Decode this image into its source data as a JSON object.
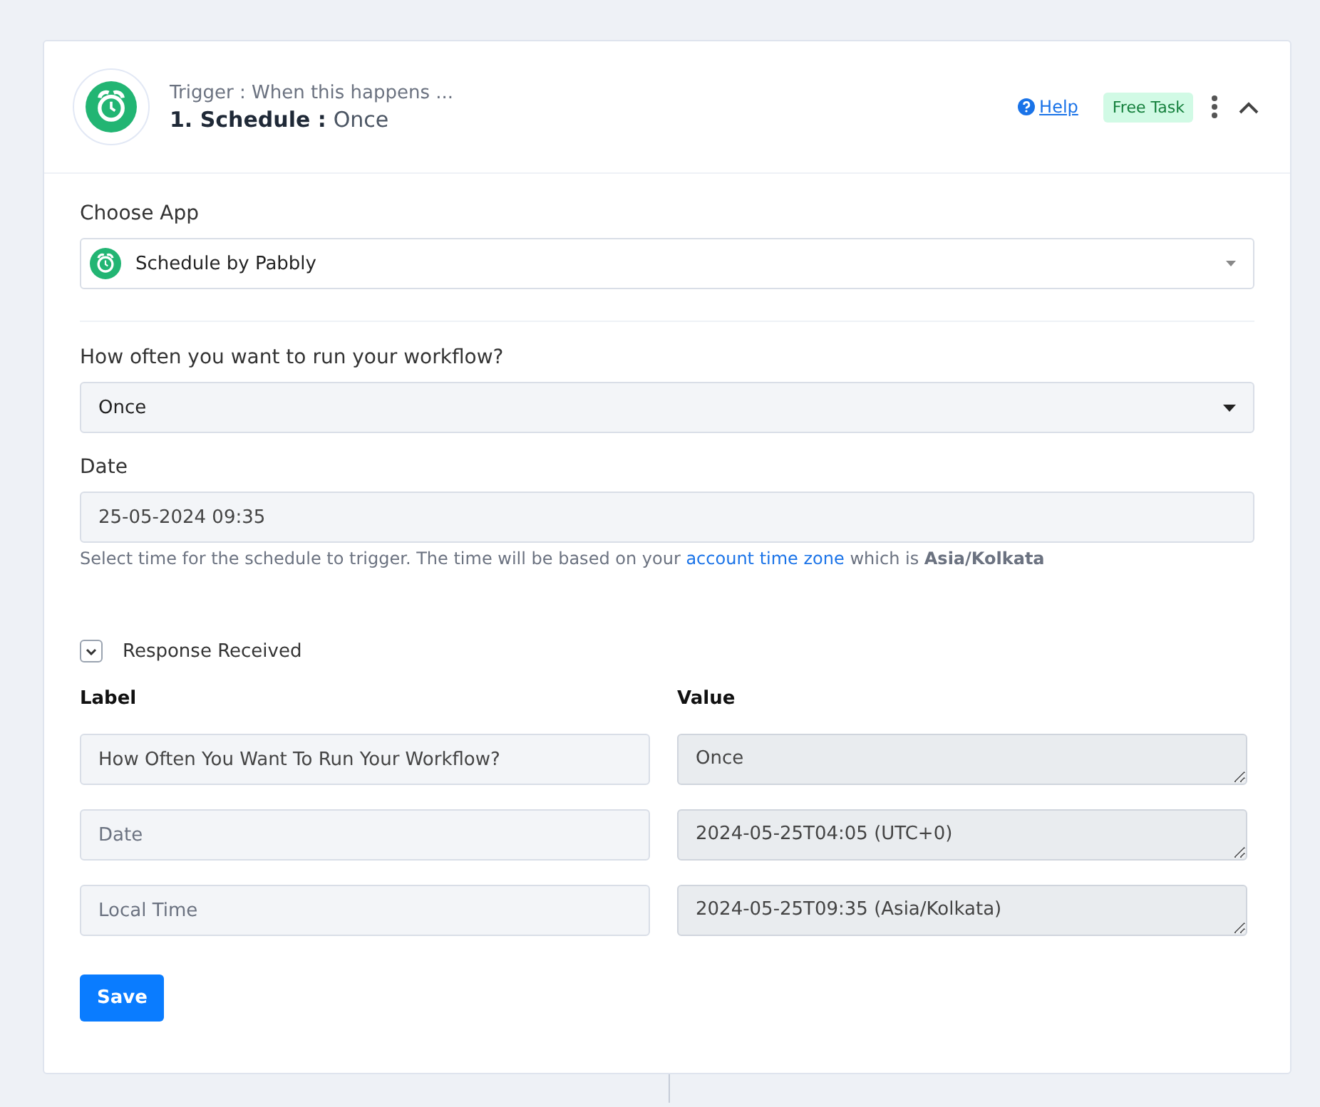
{
  "header": {
    "subtitle": "Trigger : When this happens ...",
    "title": "1. Schedule :",
    "title_value": "Once",
    "help_link": "Help",
    "badge": "Free Task",
    "collapsed": false
  },
  "choose_app": {
    "label": "Choose App",
    "value": "Schedule by Pabbly"
  },
  "frequency": {
    "label": "How often you want to run your workflow?",
    "value": "Once"
  },
  "date": {
    "label": "Date",
    "value": "25-05-2024 09:35",
    "hint_before": "Select time for the schedule to trigger. The time will be based on your",
    "hint_link": "account time zone",
    "hint_after": "which is **Asia/Kolkata**"
  },
  "response": {
    "label": "Response Received",
    "expanded": true,
    "columns": [
      "Label",
      "Value"
    ],
    "rows": [
      {
        "label": {
          "value": "How Often You Want To Run Your Workflow?"
        },
        "value": "Once"
      },
      {
        "label": {
          "placeholder": "Date"
        },
        "value": "2024-05-25T04:05 (UTC+0)"
      },
      {
        "label": {
          "placeholder": "Local Time"
        },
        "value": "2024-05-25T09:35 (Asia/Kolkata)"
      }
    ]
  },
  "save_button": "Save"
}
